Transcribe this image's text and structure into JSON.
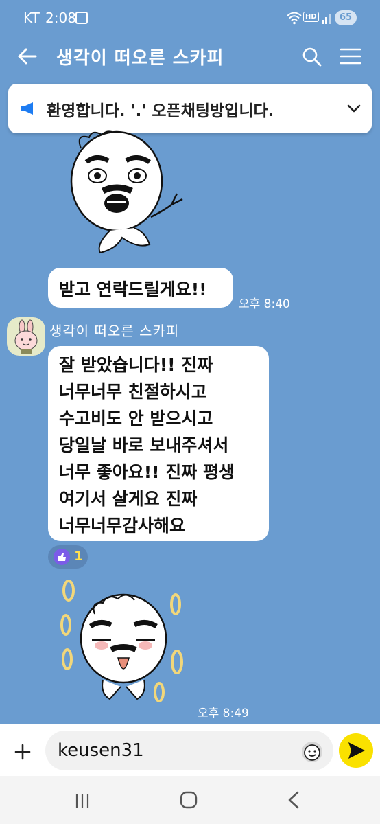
{
  "status_bar": {
    "carrier": "KT",
    "time": "2:08",
    "hd_label": "HD",
    "battery": "65"
  },
  "app_bar": {
    "title": "생각이 떠오른 스카피"
  },
  "notice": {
    "text": "환영합니다. '.' 오픈채팅방입니다."
  },
  "messages": [
    {
      "type": "bubble",
      "text": "받고 연락드릴게요!!",
      "time": "오후 8:40"
    },
    {
      "type": "bubble",
      "sender": "생각이 떠오른 스카피",
      "text": "잘 받았습니다!! 진짜\n너무너무 친절하시고\n수고비도 안 받으시고\n당일날 바로 보내주셔서\n너무 좋아요!! 진짜 평생\n여기서 살게요 진짜\n너무너무감사해요",
      "reaction": {
        "icon": "thumbs-up-icon",
        "count": "1"
      }
    },
    {
      "type": "sticker",
      "time": "오후 8:49"
    }
  ],
  "input": {
    "value": "keusen31"
  },
  "colors": {
    "chat_background": "#6a9cd0",
    "send_button": "#fae100",
    "reaction_icon": "#7b5ce8",
    "notice_icon": "#1d7cf2"
  }
}
